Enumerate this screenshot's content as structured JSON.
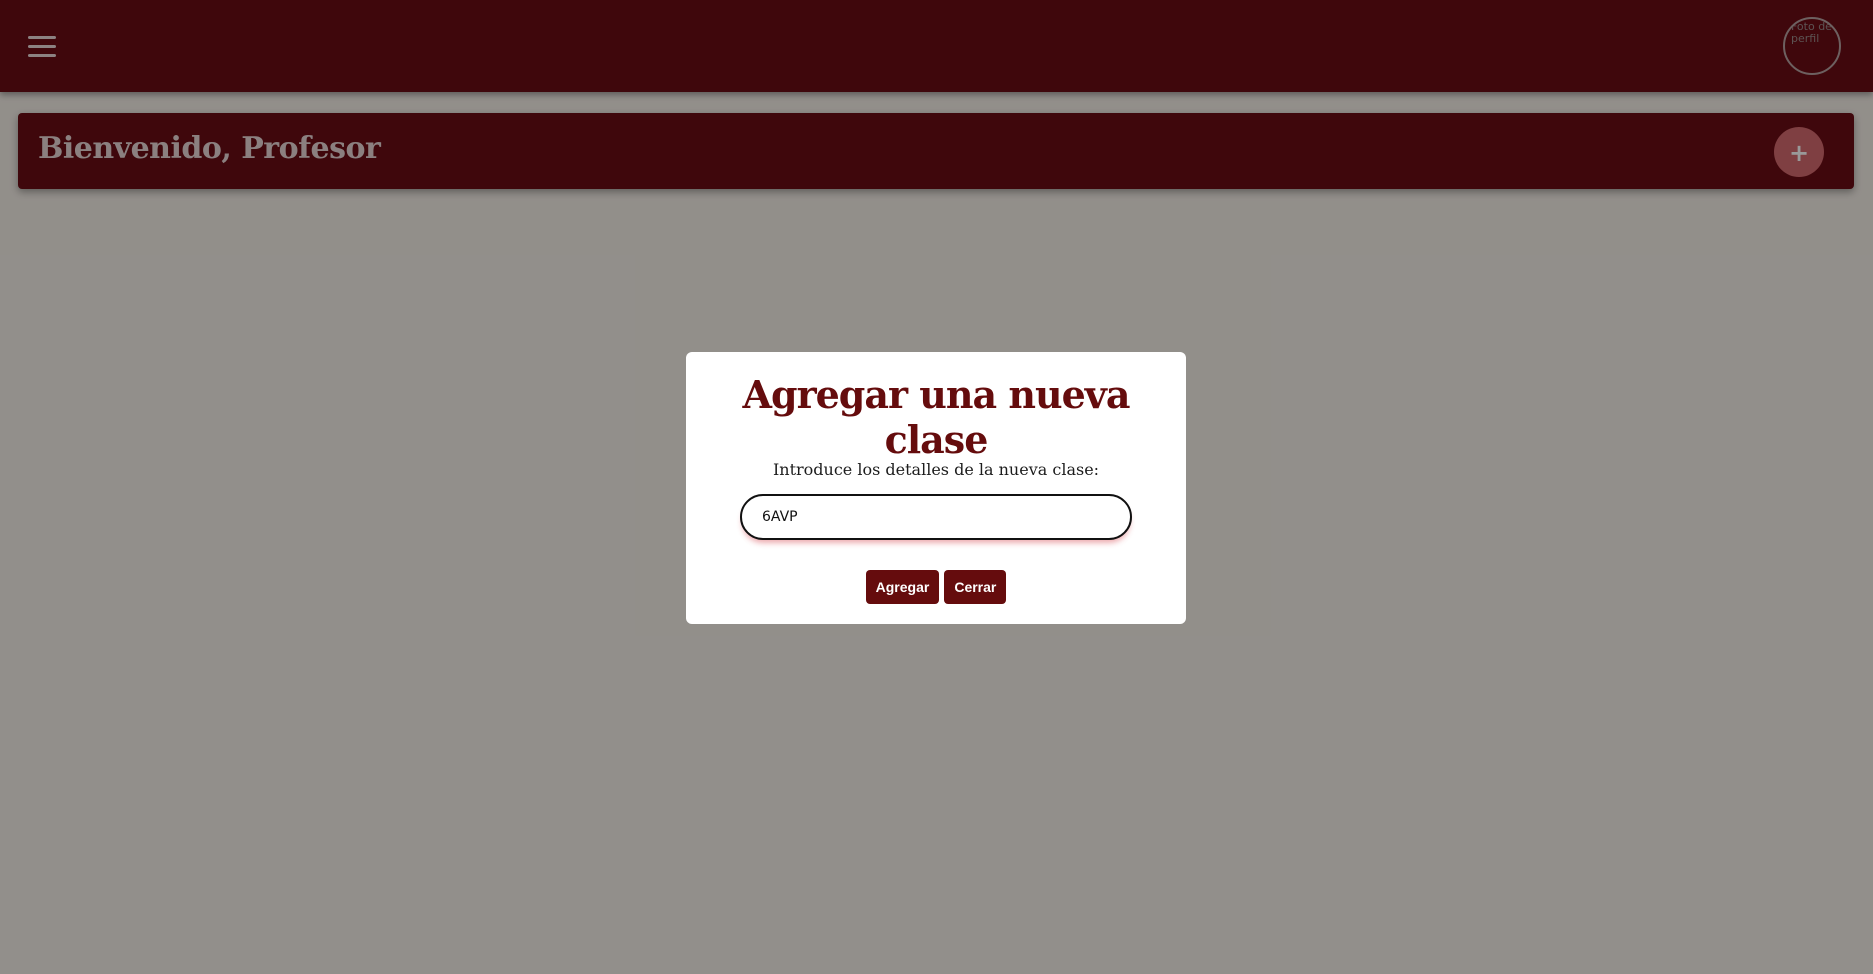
{
  "header": {
    "menu_icon": "hamburger-icon",
    "avatar_alt": "Foto de perfil"
  },
  "welcome": {
    "title": "Bienvenido, Profesor",
    "add_button_label": "+"
  },
  "modal": {
    "title": "Agregar una nueva clase",
    "label": "Introduce los detalles de la nueva clase:",
    "input_value": "6AVP",
    "add_label": "Agregar",
    "close_label": "Cerrar"
  },
  "colors": {
    "primary": "#6a0d14",
    "accent": "#d4696f",
    "modal_title": "#650c0d"
  }
}
